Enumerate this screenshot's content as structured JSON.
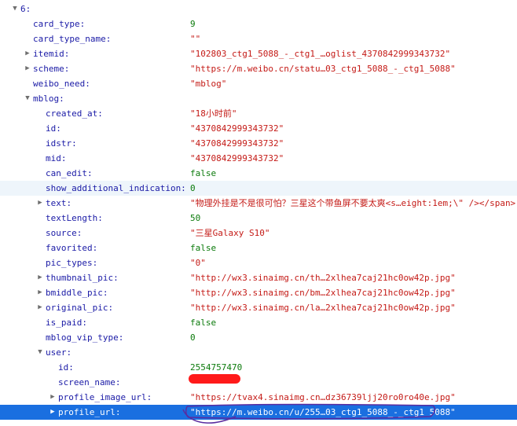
{
  "root": {
    "key": "6:"
  },
  "rows": [
    {
      "key": "card_type:",
      "value": "9",
      "type": "num",
      "toggle": "",
      "alt": false
    },
    {
      "key": "card_type_name:",
      "value": "\"\"",
      "type": "str",
      "toggle": "",
      "alt": false
    },
    {
      "key": "itemid:",
      "value": "\"102803_ctg1_5088_-_ctg1_…oglist_4370842999343732\"",
      "type": "str",
      "toggle": "▶",
      "alt": false
    },
    {
      "key": "scheme:",
      "value": "\"https://m.weibo.cn/statu…03_ctg1_5088_-_ctg1_5088\"",
      "type": "str",
      "toggle": "▶",
      "alt": false
    },
    {
      "key": "weibo_need:",
      "value": "\"mblog\"",
      "type": "str",
      "toggle": "",
      "alt": false
    },
    {
      "key": "mblog:",
      "value": "",
      "type": "obj",
      "toggle": "▼",
      "alt": false
    },
    {
      "key": "created_at:",
      "value": "\"18小时前\"",
      "type": "str",
      "toggle": "",
      "alt": false
    },
    {
      "key": "id:",
      "value": "\"4370842999343732\"",
      "type": "str",
      "toggle": "",
      "alt": false
    },
    {
      "key": "idstr:",
      "value": "\"4370842999343732\"",
      "type": "str",
      "toggle": "",
      "alt": false
    },
    {
      "key": "mid:",
      "value": "\"4370842999343732\"",
      "type": "str",
      "toggle": "",
      "alt": false
    },
    {
      "key": "can_edit:",
      "value": "false",
      "type": "bool",
      "toggle": "",
      "alt": false
    },
    {
      "key": "show_additional_indication:",
      "value": "0",
      "type": "num",
      "toggle": "",
      "alt": true
    },
    {
      "key": "text:",
      "value": "\"物理外挂是不是很可怕？三星这个带鱼屏不要太爽<s…eight:1em;\\\" /></span> \"",
      "type": "str",
      "toggle": "▶",
      "alt": false
    },
    {
      "key": "textLength:",
      "value": "50",
      "type": "num",
      "toggle": "",
      "alt": false
    },
    {
      "key": "source:",
      "value": "\"三星Galaxy S10\"",
      "type": "str",
      "toggle": "",
      "alt": false
    },
    {
      "key": "favorited:",
      "value": "false",
      "type": "bool",
      "toggle": "",
      "alt": false
    },
    {
      "key": "pic_types:",
      "value": "\"0\"",
      "type": "str",
      "toggle": "",
      "alt": false
    },
    {
      "key": "thumbnail_pic:",
      "value": "\"http://wx3.sinaimg.cn/th…2xlhea7caj21hc0ow42p.jpg\"",
      "type": "str",
      "toggle": "▶",
      "alt": false
    },
    {
      "key": "bmiddle_pic:",
      "value": "\"http://wx3.sinaimg.cn/bm…2xlhea7caj21hc0ow42p.jpg\"",
      "type": "str",
      "toggle": "▶",
      "alt": false
    },
    {
      "key": "original_pic:",
      "value": "\"http://wx3.sinaimg.cn/la…2xlhea7caj21hc0ow42p.jpg\"",
      "type": "str",
      "toggle": "▶",
      "alt": false
    },
    {
      "key": "is_paid:",
      "value": "false",
      "type": "bool",
      "toggle": "",
      "alt": false
    },
    {
      "key": "mblog_vip_type:",
      "value": "0",
      "type": "num",
      "toggle": "",
      "alt": false
    },
    {
      "key": "user:",
      "value": "",
      "type": "obj",
      "toggle": "▼",
      "alt": false
    },
    {
      "key": "id:",
      "value": "2554757470",
      "type": "num",
      "toggle": "",
      "alt": false
    },
    {
      "key": "screen_name:",
      "value": "",
      "type": "redacted",
      "toggle": "",
      "alt": false
    },
    {
      "key": "profile_image_url:",
      "value": "\"https://tvax4.sinaimg.cn…dz36739ljj20ro0ro40e.jpg\"",
      "type": "str",
      "toggle": "▶",
      "alt": false
    },
    {
      "key": "profile_url:",
      "value": "\"https://m.weibo.cn/u/255…03_ctg1_5088_-_ctg1_5088\"",
      "type": "str",
      "toggle": "▶",
      "alt": false,
      "selected": true
    }
  ],
  "colors": {
    "key": "#1a1aa6",
    "string": "#c41a16",
    "number": "#0b7a0b",
    "selection": "#1a6fe0",
    "redaction": "#ff1a1a",
    "annotation": "#5a2ca0"
  }
}
